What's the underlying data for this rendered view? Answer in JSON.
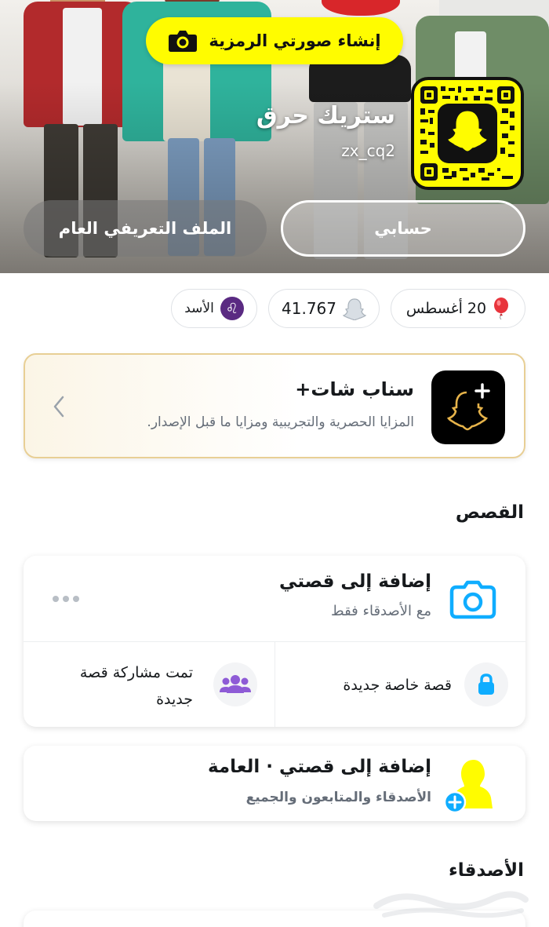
{
  "hero": {
    "create_bitmoji_label": "إنشاء صورتي الرمزية",
    "display_name": "ستريك حرق",
    "username": "zx_cq2",
    "my_account_label": "حسابي",
    "public_profile_label": "الملف التعريفي العام"
  },
  "chips": {
    "birthday": "20 أغسطس",
    "snap_score": "41.767",
    "zodiac": "الأسد"
  },
  "snapchat_plus": {
    "title": "سناب شات+",
    "subtitle": "المزايا الحصرية والتجريبية ومزايا ما قبل الإصدار."
  },
  "stories": {
    "section_title": "القصص",
    "add_story_title": "إضافة إلى قصتي",
    "add_story_sub": "مع الأصدقاء فقط",
    "new_private_story": "قصة خاصة جديدة",
    "new_shared_story": "تمت مشاركة قصة جديدة"
  },
  "public_story": {
    "title": "إضافة إلى قصتي · العامة",
    "subtitle": "الأصدقاء والمتابعون والجميع"
  },
  "friends": {
    "section_title": "الأصدقاء"
  },
  "colors": {
    "snap_yellow": "#fffc00",
    "accent_blue": "#0fadff",
    "purple": "#8e5bd6"
  }
}
